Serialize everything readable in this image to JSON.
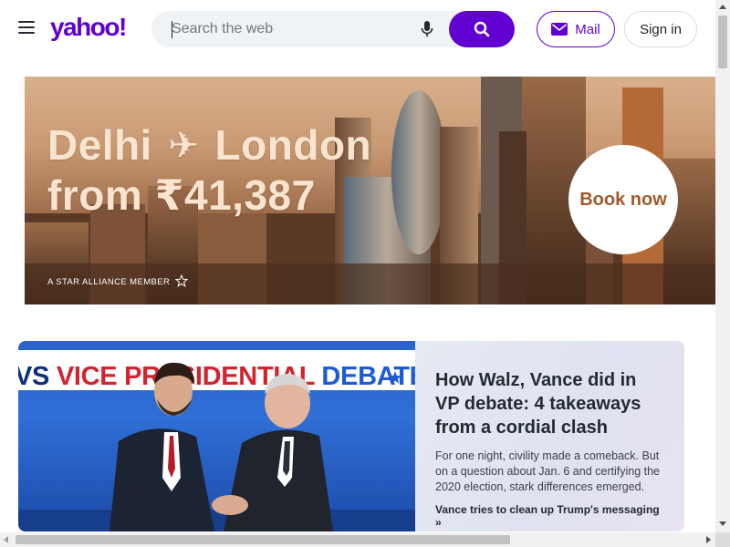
{
  "header": {
    "logo_text": "yahoo!",
    "search": {
      "placeholder": "Search the web",
      "value": ""
    },
    "mail_label": "Mail",
    "signin_label": "Sign in",
    "icons": [
      "menu-icon",
      "mic-icon",
      "search-icon",
      "mail-icon"
    ]
  },
  "ad": {
    "headline_line1_from": "Delhi",
    "headline_line1_to": "London",
    "plane_glyph": "✈",
    "headline_line2": "from ₹41,387",
    "tagline": "A STAR ALLIANCE MEMBER",
    "cta": "Book now"
  },
  "news": {
    "image_banner": {
      "part1": "VS ",
      "part2": "VICE PRESIDENTIAL ",
      "part3": "DEBATE"
    },
    "title": "How Walz, Vance did in VP debate: 4 takeaways from a cordial clash",
    "summary": "For one night, civility made a comeback. But on a question about Jan. 6 and certifying the 2020 election, stark differences emerged.",
    "related_link": "Vance tries to clean up Trump's messaging »"
  },
  "colors": {
    "brand": "#6001d2",
    "ad_text": "#f9e4cf",
    "ad_cta": "#a25a2b",
    "debate_red": "#d3232f",
    "debate_blue": "#1d5ad6"
  }
}
